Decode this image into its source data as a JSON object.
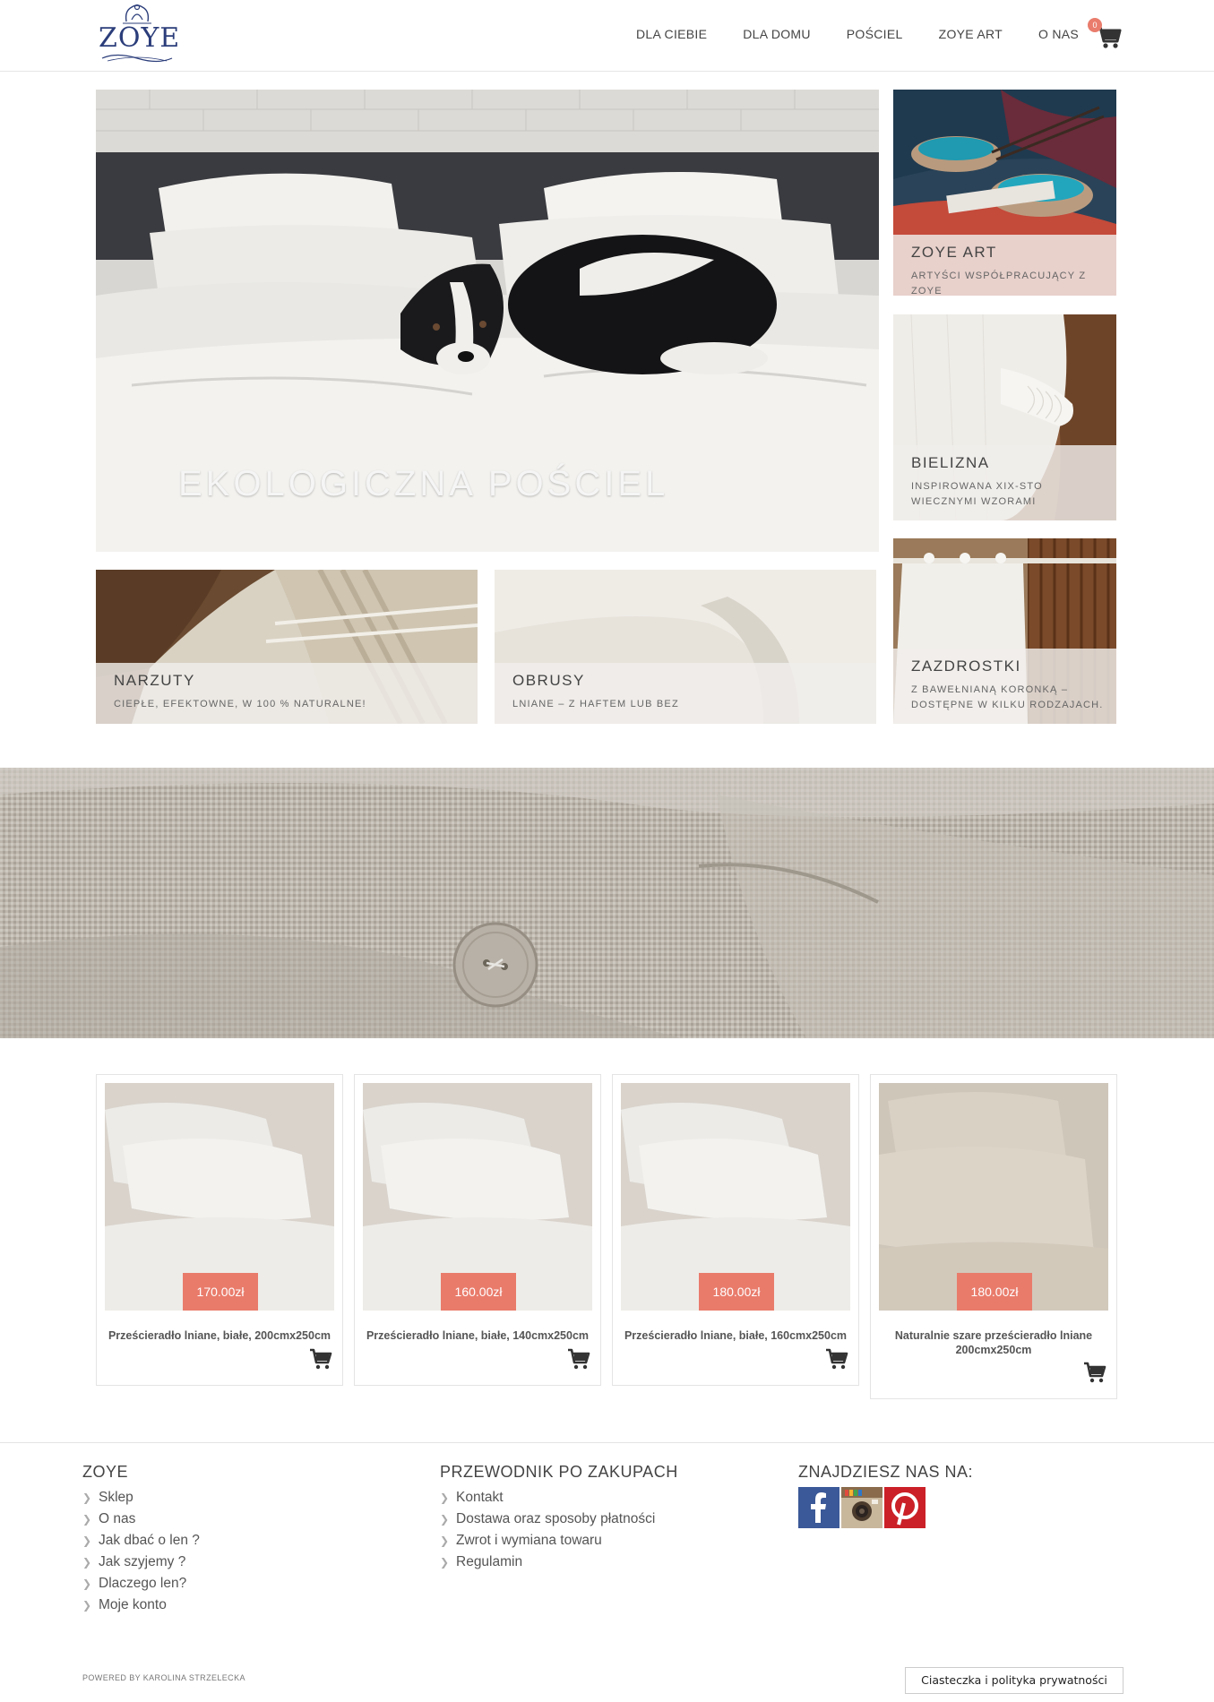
{
  "brand": {
    "name": "ZOYE"
  },
  "nav": {
    "items": [
      {
        "label": "DLA CIEBIE"
      },
      {
        "label": "DLA DOMU"
      },
      {
        "label": "POŚCIEL"
      },
      {
        "label": "ZOYE ART"
      },
      {
        "label": "O NAS"
      }
    ],
    "cart_count": "0"
  },
  "hero": {
    "title": "EKOLOGICZNA POŚCIEL"
  },
  "tiles": {
    "zoye_art": {
      "title": "ZOYE ART",
      "subtitle": "ARTYŚCI WSPÓŁPRACUJĄCY Z ZOYE"
    },
    "bielizna": {
      "title": "BIELIZNA",
      "subtitle": "INSPIROWANA XIX-STO WIECZNYMI WZORAMI"
    },
    "narzuty": {
      "title": "NARZUTY",
      "subtitle": "CIEPŁE, EFEKTOWNE, W 100 % NATURALNE!"
    },
    "obrusy": {
      "title": "OBRUSY",
      "subtitle": "LNIANE – Z HAFTEM LUB BEZ"
    },
    "zazdrostki": {
      "title": "ZAZDROSTKI",
      "subtitle": "Z BAWEŁNIANĄ KORONKĄ – DOSTĘPNE W KILKU RODZAJACH."
    }
  },
  "products": [
    {
      "price": "170.00zł",
      "name": "Prześcieradło lniane, białe, 200cmx250cm"
    },
    {
      "price": "160.00zł",
      "name": "Prześcieradło lniane, białe, 140cmx250cm"
    },
    {
      "price": "180.00zł",
      "name": "Prześcieradło lniane, białe, 160cmx250cm"
    },
    {
      "price": "180.00zł",
      "name": "Naturalnie szare prześcieradło lniane 200cmx250cm"
    }
  ],
  "footer": {
    "col1": {
      "heading": "ZOYE",
      "links": [
        "Sklep",
        "O nas",
        "Jak dbać o len ?",
        "Jak szyjemy ?",
        "Dlaczego len?",
        "Moje konto"
      ]
    },
    "col2": {
      "heading": "PRZEWODNIK PO ZAKUPACH",
      "links": [
        "Kontakt",
        "Dostawa oraz sposoby płatności",
        "Zwrot i wymiana towaru",
        "Regulamin"
      ]
    },
    "col3": {
      "heading": "ZNAJDZIESZ NAS NA:"
    },
    "powered": "POWERED BY KAROLINA STRZELECKA",
    "cookie": "Ciasteczka i polityka prywatności"
  },
  "colors": {
    "price_bg": "#e97b6b",
    "logo": "#2b3d7a",
    "facebook": "#3b5998",
    "pinterest": "#cb2027"
  }
}
